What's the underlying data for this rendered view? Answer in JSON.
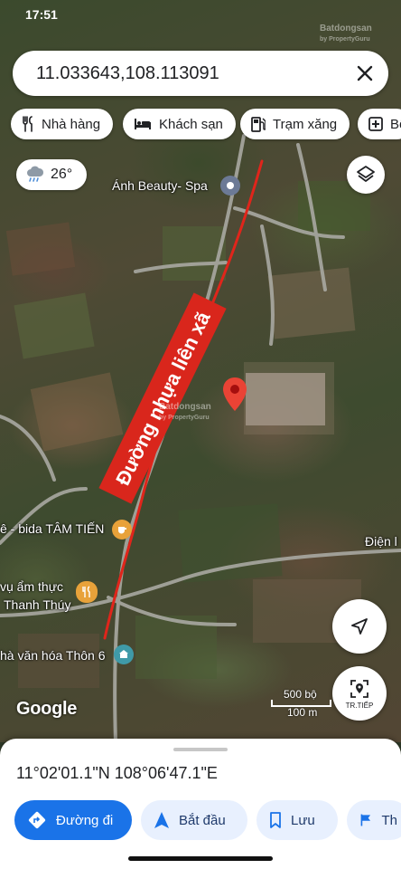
{
  "status": {
    "time": "17:51"
  },
  "watermark": {
    "brand": "Batdongsan",
    "sub": "by PropertyGuru"
  },
  "search": {
    "value": "11.033643,108.113091"
  },
  "chips": [
    {
      "icon": "fork-knife-icon",
      "label": "Nhà hàng"
    },
    {
      "icon": "bed-icon",
      "label": "Khách sạn"
    },
    {
      "icon": "gas-station-icon",
      "label": "Trạm xăng"
    },
    {
      "icon": "pharmacy-plus-icon",
      "label": "Bệ"
    }
  ],
  "weather": {
    "icon": "rain-cloud-icon",
    "temp": "26°"
  },
  "map": {
    "road_annotation": "Đường nhựa liên xã",
    "places": {
      "beauty_spa": "Ánh Beauty- Spa",
      "cafe": "ê - bida TÂM TIẾN",
      "food_line1": "vụ ẩm thực",
      "food_line2": "Thanh Thúy",
      "culture_house": "hà văn hóa Thôn 6",
      "power": "Điện l"
    },
    "google": "Google",
    "scale_ft": "500 bộ",
    "scale_m": "100 m",
    "pin_color": "#ea4335"
  },
  "controls": {
    "layers_icon": "layers-icon",
    "locate_icon": "navigation-arrow-icon",
    "next_label": "TR.TIẾP"
  },
  "sheet": {
    "coords": "11°02'01.1\"N 108°06'47.1\"E",
    "actions": [
      {
        "icon": "directions-icon",
        "label": "Đường đi"
      },
      {
        "icon": "start-arrow-icon",
        "label": "Bắt đầu"
      },
      {
        "icon": "bookmark-icon",
        "label": "Lưu"
      },
      {
        "icon": "flag-icon",
        "label": "Th"
      }
    ],
    "accent": "#1a73e8"
  }
}
